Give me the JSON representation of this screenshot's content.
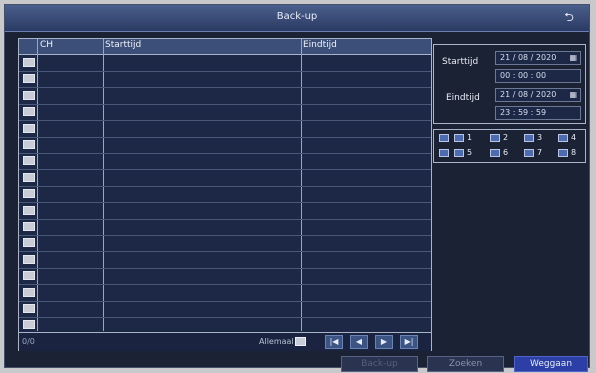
{
  "window": {
    "title": "Back-up",
    "back_icon": "return-arrow-icon"
  },
  "table": {
    "columns": [
      "CH",
      "Starttijd",
      "Eindtijd"
    ],
    "row_count": 17,
    "footer": {
      "count": "0/0",
      "select_all_label": "Allemaal"
    }
  },
  "pager": {
    "first": "|◀",
    "prev": "◀",
    "next": "▶",
    "last": "▶|"
  },
  "search": {
    "start_label": "Starttijd",
    "start_date": "21 / 08 / 2020",
    "start_time": "00  :  00  :  00",
    "end_label": "Eindtijd",
    "end_date": "21 / 08 / 2020",
    "end_time": "23  :  59  :  59",
    "calendar_icon": "calendar-icon"
  },
  "channels": {
    "all_checked": true,
    "items": [
      {
        "label": "1",
        "checked": true
      },
      {
        "label": "2",
        "checked": true
      },
      {
        "label": "3",
        "checked": true
      },
      {
        "label": "4",
        "checked": true
      },
      {
        "label": "5",
        "checked": true
      },
      {
        "label": "6",
        "checked": true
      },
      {
        "label": "7",
        "checked": true
      },
      {
        "label": "8",
        "checked": true
      }
    ]
  },
  "buttons": {
    "backup": "Back-up",
    "search": "Zoeken",
    "cancel": "Weggaan"
  },
  "colors": {
    "accent": "#2b3fa6",
    "panel_bg": "#1b2233",
    "header_bg": "#3c4f78"
  }
}
